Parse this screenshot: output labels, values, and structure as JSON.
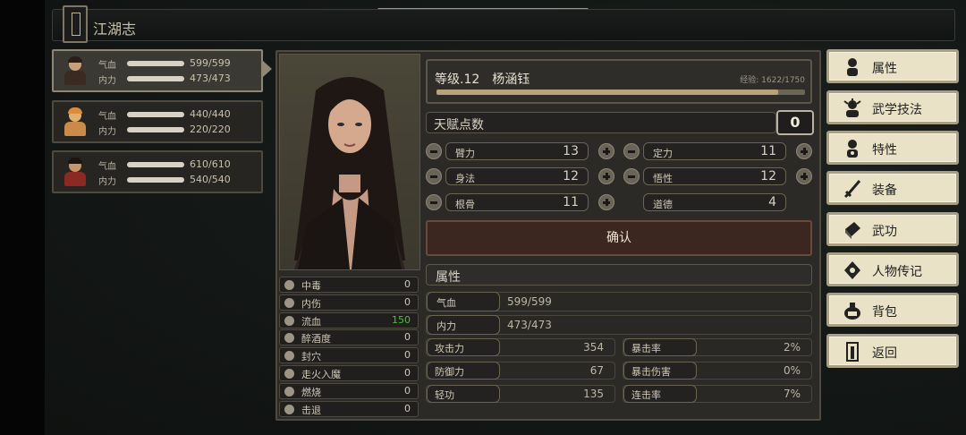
{
  "title": "江湖志",
  "party": [
    {
      "hp_label": "气血",
      "hp": "599/599",
      "mp_label": "内力",
      "mp": "473/473"
    },
    {
      "hp_label": "气血",
      "hp": "440/440",
      "mp_label": "内力",
      "mp": "220/220"
    },
    {
      "hp_label": "气血",
      "hp": "610/610",
      "mp_label": "内力",
      "mp": "540/540"
    }
  ],
  "character": {
    "level_name": "等级.12　杨涵钰",
    "exp_label": "经验: 1622/1750",
    "exp_fraction": 0.927
  },
  "talent": {
    "label": "天赋点数",
    "value": "0"
  },
  "attributes": [
    {
      "name": "臂力",
      "value": "13"
    },
    {
      "name": "定力",
      "value": "11"
    },
    {
      "name": "身法",
      "value": "12"
    },
    {
      "name": "悟性",
      "value": "12"
    },
    {
      "name": "根骨",
      "value": "11"
    },
    {
      "name": "道德",
      "value": "4"
    }
  ],
  "confirm_label": "确认",
  "section_title": "属性",
  "stats": {
    "hp_label": "气血",
    "hp_value": "599/599",
    "mp_label": "内力",
    "mp_value": "473/473",
    "rows": [
      {
        "l_name": "攻击力",
        "l_value": "354",
        "r_name": "暴击率",
        "r_value": "2%"
      },
      {
        "l_name": "防御力",
        "l_value": "67",
        "r_name": "暴击伤害",
        "r_value": "0%"
      },
      {
        "l_name": "轻功",
        "l_value": "135",
        "r_name": "连击率",
        "r_value": "7%"
      }
    ]
  },
  "status_effects": [
    {
      "name": "中毒",
      "value": "0",
      "icon": "skull-icon"
    },
    {
      "name": "内伤",
      "value": "0",
      "icon": "broken-heart-icon"
    },
    {
      "name": "流血",
      "value": "150",
      "icon": "blood-drop-icon"
    },
    {
      "name": "醉酒度",
      "value": "0",
      "icon": "wine-icon"
    },
    {
      "name": "封穴",
      "value": "0",
      "icon": "pressure-point-icon"
    },
    {
      "name": "走火入魔",
      "value": "0",
      "icon": "demon-icon"
    },
    {
      "name": "燃烧",
      "value": "0",
      "icon": "fire-icon"
    },
    {
      "name": "击退",
      "value": "0",
      "icon": "knockback-icon"
    }
  ],
  "menu": [
    {
      "label": "属性",
      "icon": "character-icon"
    },
    {
      "label": "武学技法",
      "icon": "martial-skill-icon"
    },
    {
      "label": "特性",
      "icon": "trait-icon"
    },
    {
      "label": "装备",
      "icon": "sword-icon"
    },
    {
      "label": "武功",
      "icon": "book-icon"
    },
    {
      "label": "人物传记",
      "icon": "biography-icon"
    },
    {
      "label": "背包",
      "icon": "bag-icon"
    },
    {
      "label": "返回",
      "icon": "door-icon"
    }
  ],
  "colors": {
    "accent": "#b7a27a",
    "green_value": "#4bbf3a",
    "confirm_bg": "#3b2620"
  }
}
